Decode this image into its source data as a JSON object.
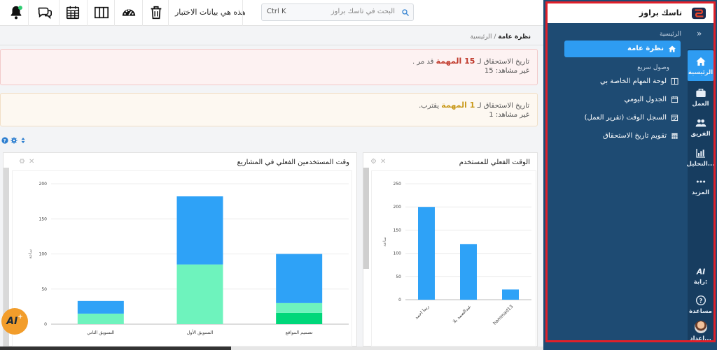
{
  "topbar": {
    "demo_text": "هذه هي بيانات الاختبار",
    "search_placeholder": "البحث في تاسك براوز",
    "search_shortcut": "Ctrl K",
    "icons": [
      "notification-bell-icon",
      "chat-icon",
      "calendar-icon",
      "columns-icon",
      "dashboard-gauge-icon",
      "trash-icon",
      "search-icon"
    ]
  },
  "sidebar": {
    "brand": "تاسك براوز",
    "section_home": "الرئيسية",
    "active_item": "نظرة عامة",
    "quick_access_label": "وصول سريع",
    "quick_links": [
      "لوحة المهام الخاصة بي",
      "الجدول اليومي",
      "السجل الوقت (تقرير العمل)",
      "تقويم تاريخ الاستحقاق"
    ],
    "rail": {
      "home": "الرئيسية",
      "work": "العمل",
      "team": "الفريق",
      "analytics": "التحليل...",
      "more": "المزيد",
      "ai": "رابة:",
      "help": "مساعدة",
      "settings": "إعداد..."
    }
  },
  "breadcrumb": {
    "root": "الرئيسية",
    "current": "نظرة عامة",
    "sep": "/"
  },
  "alerts": [
    {
      "prefix": "تاريخ الاستحقاق لـ",
      "count": "15 المهمة",
      "suffix": "قد مر .",
      "seen": "غير مشاهد: 15",
      "color": "#c0392b"
    },
    {
      "prefix": "تاريخ الاستحقاق لـ",
      "count": "1 المهمة",
      "suffix": "يقترب.",
      "seen": "غير مشاهد: 1",
      "color": "#c99a1c"
    }
  ],
  "widgets": {
    "projects_title": "وقت المستخدمين الفعلي في المشاريع",
    "users_title": "الوقت الفعلي للمستخدم"
  },
  "ai_button": "AI",
  "colors": {
    "sidebar": "#1e4b73",
    "accent": "#2e9cf2",
    "frame": "#e0202a"
  },
  "chart_data": [
    {
      "type": "bar",
      "title": "وقت المستخدمين الفعلي في المشاريع",
      "stacked": true,
      "categories": [
        "التسويق الثاني",
        "التسويق الأول",
        "تصميم المواقع"
      ],
      "series": [
        {
          "color": "#00d77a",
          "values": [
            0,
            0,
            16
          ]
        },
        {
          "color": "#6ef3bd",
          "values": [
            15,
            85,
            14
          ]
        },
        {
          "color": "#2ea2f7",
          "values": [
            18,
            97,
            70
          ]
        }
      ],
      "ylabel": "ساعة",
      "ylim": [
        0,
        200
      ],
      "yticks": [
        0,
        50,
        100,
        150,
        200
      ],
      "grid": true
    },
    {
      "type": "bar",
      "title": "الوقت الفعلي للمستخدم",
      "categories": [
        "ريما احمد",
        "عبدالصمد بلا",
        "hammad13"
      ],
      "values": [
        200,
        120,
        22
      ],
      "color": "#2ea2f7",
      "ylabel": "ساعة",
      "ylim": [
        0,
        250
      ],
      "yticks": [
        0,
        50,
        100,
        150,
        200,
        250
      ],
      "grid": true
    }
  ]
}
